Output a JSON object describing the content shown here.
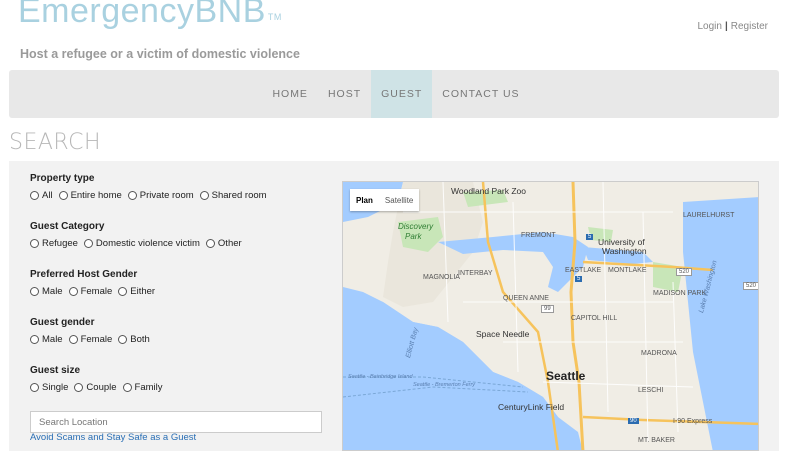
{
  "header": {
    "logo": "EmergencyBNB",
    "logo_tm": "TM",
    "tagline": "Host a refugee or a victim of domestic violence",
    "login": "Login",
    "separator": "|",
    "register": "Register"
  },
  "nav": {
    "items": [
      {
        "label": "HOME",
        "active": false
      },
      {
        "label": "HOST",
        "active": false
      },
      {
        "label": "GUEST",
        "active": true
      },
      {
        "label": "CONTACT US",
        "active": false
      }
    ]
  },
  "search": {
    "title": "SEARCH",
    "property_type": {
      "label": "Property type",
      "options": [
        "All",
        "Entire home",
        "Private room",
        "Shared room"
      ]
    },
    "guest_category": {
      "label": "Guest Category",
      "options": [
        "Refugee",
        "Domestic violence victim",
        "Other"
      ]
    },
    "host_gender": {
      "label": "Preferred Host Gender",
      "options": [
        "Male",
        "Female",
        "Either"
      ]
    },
    "guest_gender": {
      "label": "Guest gender",
      "options": [
        "Male",
        "Female",
        "Both"
      ]
    },
    "guest_size": {
      "label": "Guest size",
      "options": [
        "Single",
        "Couple",
        "Family"
      ]
    },
    "location_placeholder": "Search Location",
    "scam_link": "Avoid Scams and Stay Safe as a Guest"
  },
  "map": {
    "type_plan": "Plan",
    "type_satellite": "Satellite",
    "labels": {
      "city": "Seattle",
      "zoo": "Woodland Park Zoo",
      "discovery": "Discovery",
      "discovery2": "Park",
      "university": "University of",
      "university2": "Washington",
      "fremont": "FREMONT",
      "eastlake": "EASTLAKE",
      "montlake": "MONTLAKE",
      "magnolia": "MAGNOLIA",
      "interbay": "INTERBAY",
      "queen_anne": "QUEEN ANNE",
      "space_needle": "Space Needle",
      "capitol_hill": "CAPITOL HILL",
      "madison_park": "MADISON PARK",
      "madrona": "MADRONA",
      "centurylink": "CenturyLink Field",
      "lake_washington": "Lake Washington",
      "elliott_bay": "Elliott Bay",
      "laurelhurst": "LAURELHURST",
      "leschi": "LESCHI",
      "mt_baker": "MT. BAKER",
      "i90": "I-90 Express",
      "ferry1": "Seattle - Bainbridge Island",
      "ferry2": "Seattle - Bremerton Ferry",
      "shield_5a": "5",
      "shield_5b": "5",
      "shield_520a": "520",
      "shield_520b": "520",
      "shield_99": "99",
      "shield_90": "90"
    }
  }
}
